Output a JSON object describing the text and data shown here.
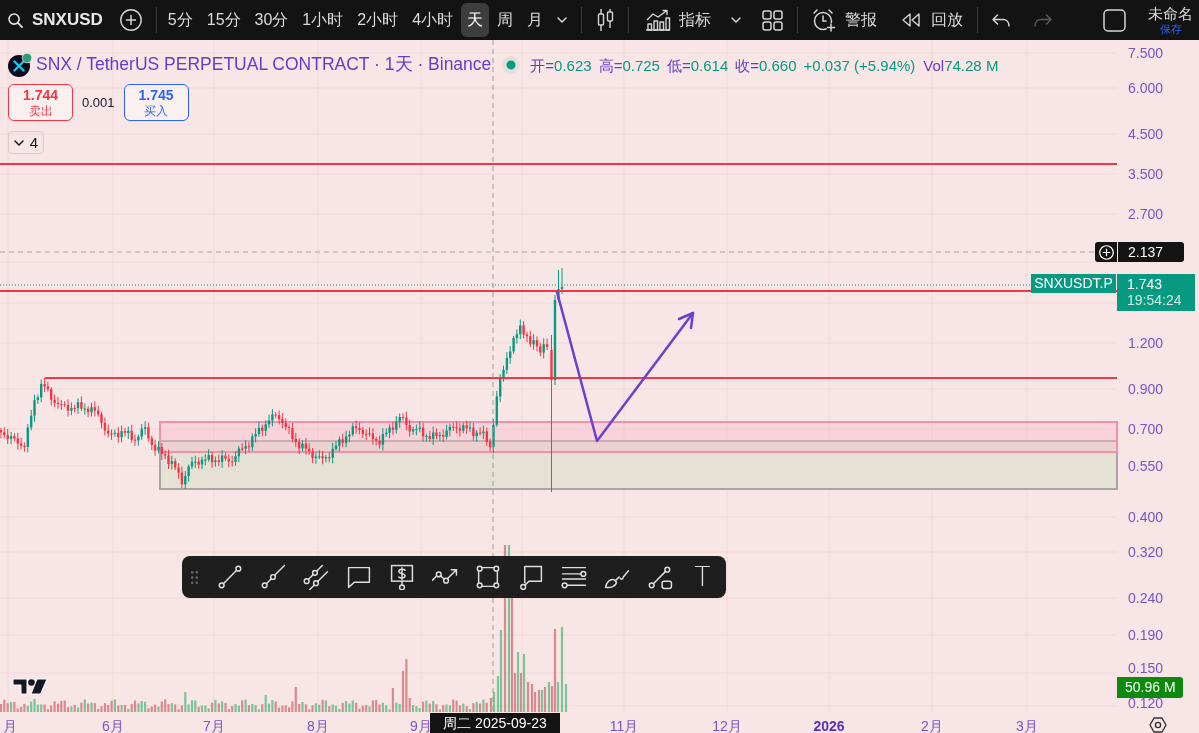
{
  "toolbar": {
    "symbol": "SNXUSD",
    "intervals": [
      {
        "label": "5分",
        "selected": false
      },
      {
        "label": "15分",
        "selected": false
      },
      {
        "label": "30分",
        "selected": false
      },
      {
        "label": "1小时",
        "selected": false
      },
      {
        "label": "2小时",
        "selected": false
      },
      {
        "label": "4小时",
        "selected": false
      },
      {
        "label": "天",
        "selected": true
      },
      {
        "label": "周",
        "selected": false
      },
      {
        "label": "月",
        "selected": false
      }
    ],
    "indicators": "指标",
    "alerts": "警报",
    "replay": "回放",
    "undo": {
      "disabled": false
    },
    "redo": {
      "disabled": true
    },
    "layout_name": "未命名",
    "save": "保存"
  },
  "legend": {
    "title": "SNX / TetherUS PERPETUAL CONTRACT · 1天 · Binance",
    "market_open": true,
    "ohlc": [
      {
        "label": "开=",
        "value": "0.623"
      },
      {
        "label": "高=",
        "value": "0.725"
      },
      {
        "label": "低=",
        "value": "0.614"
      },
      {
        "label": "收=",
        "value": "0.660"
      }
    ],
    "change": "+0.037 (+5.94%)",
    "volume_label": "Vol",
    "volume": "74.28 M",
    "sell": {
      "price": "1.744",
      "label": "卖出"
    },
    "spread": "0.001",
    "buy": {
      "price": "1.745",
      "label": "买入"
    },
    "indicator_count": "4"
  },
  "price_axis": {
    "labels": [
      "7.500",
      "6.000",
      "4.500",
      "3.500",
      "2.700",
      "1.200",
      "0.900",
      "0.700",
      "0.550",
      "0.400",
      "0.320",
      "0.240",
      "0.190",
      "0.150",
      "0.120"
    ],
    "crosshair_price": "2.137",
    "symbol_tag": "SNXUSDT.P",
    "last_price": "1.743",
    "countdown": "19:54:24",
    "volume_tag": "50.96 M"
  },
  "time_axis": {
    "labels": [
      {
        "text": "月",
        "kind": "month"
      },
      {
        "text": "6月",
        "kind": "month"
      },
      {
        "text": "7月",
        "kind": "month"
      },
      {
        "text": "8月",
        "kind": "month"
      },
      {
        "text": "9月",
        "kind": "month"
      },
      {
        "text": "11月",
        "kind": "month"
      },
      {
        "text": "12月",
        "kind": "month"
      },
      {
        "text": "2026",
        "kind": "year"
      },
      {
        "text": "2月",
        "kind": "month"
      },
      {
        "text": "3月",
        "kind": "month"
      }
    ],
    "crosshair_date": "周二 2025-09-23"
  },
  "drawing_toolbar": {
    "text_tool": "T"
  }
}
